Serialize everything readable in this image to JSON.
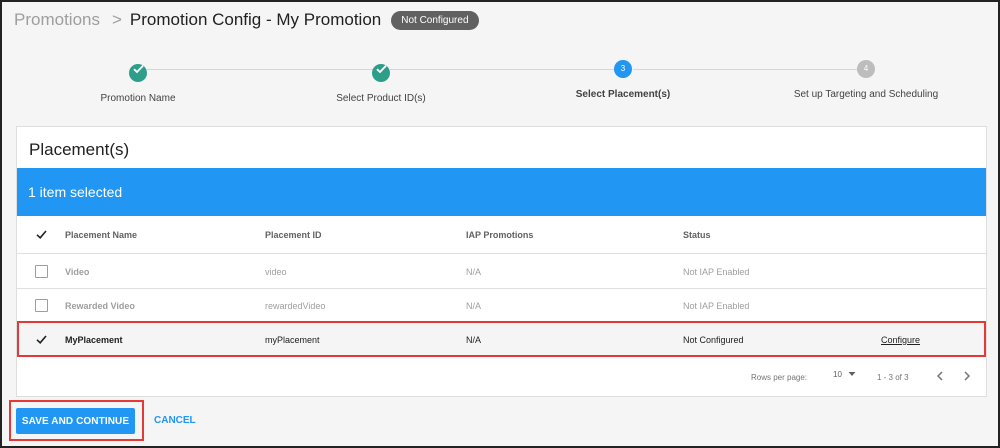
{
  "header": {
    "breadcrumb_root": "Promotions",
    "separator": ">",
    "title": "Promotion Config - My Promotion",
    "status_badge": "Not Configured"
  },
  "stepper": {
    "steps": [
      {
        "number": "1",
        "label": "Promotion Name",
        "state": "done"
      },
      {
        "number": "2",
        "label": "Select Product ID(s)",
        "state": "done"
      },
      {
        "number": "3",
        "label": "Select Placement(s)",
        "state": "active"
      },
      {
        "number": "4",
        "label": "Set up Targeting and Scheduling",
        "state": "pending"
      }
    ]
  },
  "card": {
    "title": "Placement(s)",
    "selection_text": "1 item selected",
    "columns": {
      "name": "Placement Name",
      "id": "Placement ID",
      "iap": "IAP Promotions",
      "status": "Status"
    },
    "rows": [
      {
        "name": "Video",
        "id": "video",
        "iap": "N/A",
        "status": "Not IAP Enabled",
        "action": "",
        "checked": false,
        "enabled": false
      },
      {
        "name": "Rewarded Video",
        "id": "rewardedVideo",
        "iap": "N/A",
        "status": "Not IAP Enabled",
        "action": "",
        "checked": false,
        "enabled": false
      },
      {
        "name": "MyPlacement",
        "id": "myPlacement",
        "iap": "N/A",
        "status": "Not Configured",
        "action": "Configure",
        "checked": true,
        "enabled": true
      }
    ],
    "pagination": {
      "rows_per_page_label": "Rows per page:",
      "rows_per_page_value": "10",
      "range": "1 - 3 of 3"
    }
  },
  "actions": {
    "save_label": "SAVE AND CONTINUE",
    "cancel_label": "CANCEL"
  },
  "colors": {
    "accent": "#2196f3",
    "done": "#2e9e8a",
    "pending": "#bdbdbd",
    "highlight": "#e53935",
    "badge": "#616161"
  }
}
